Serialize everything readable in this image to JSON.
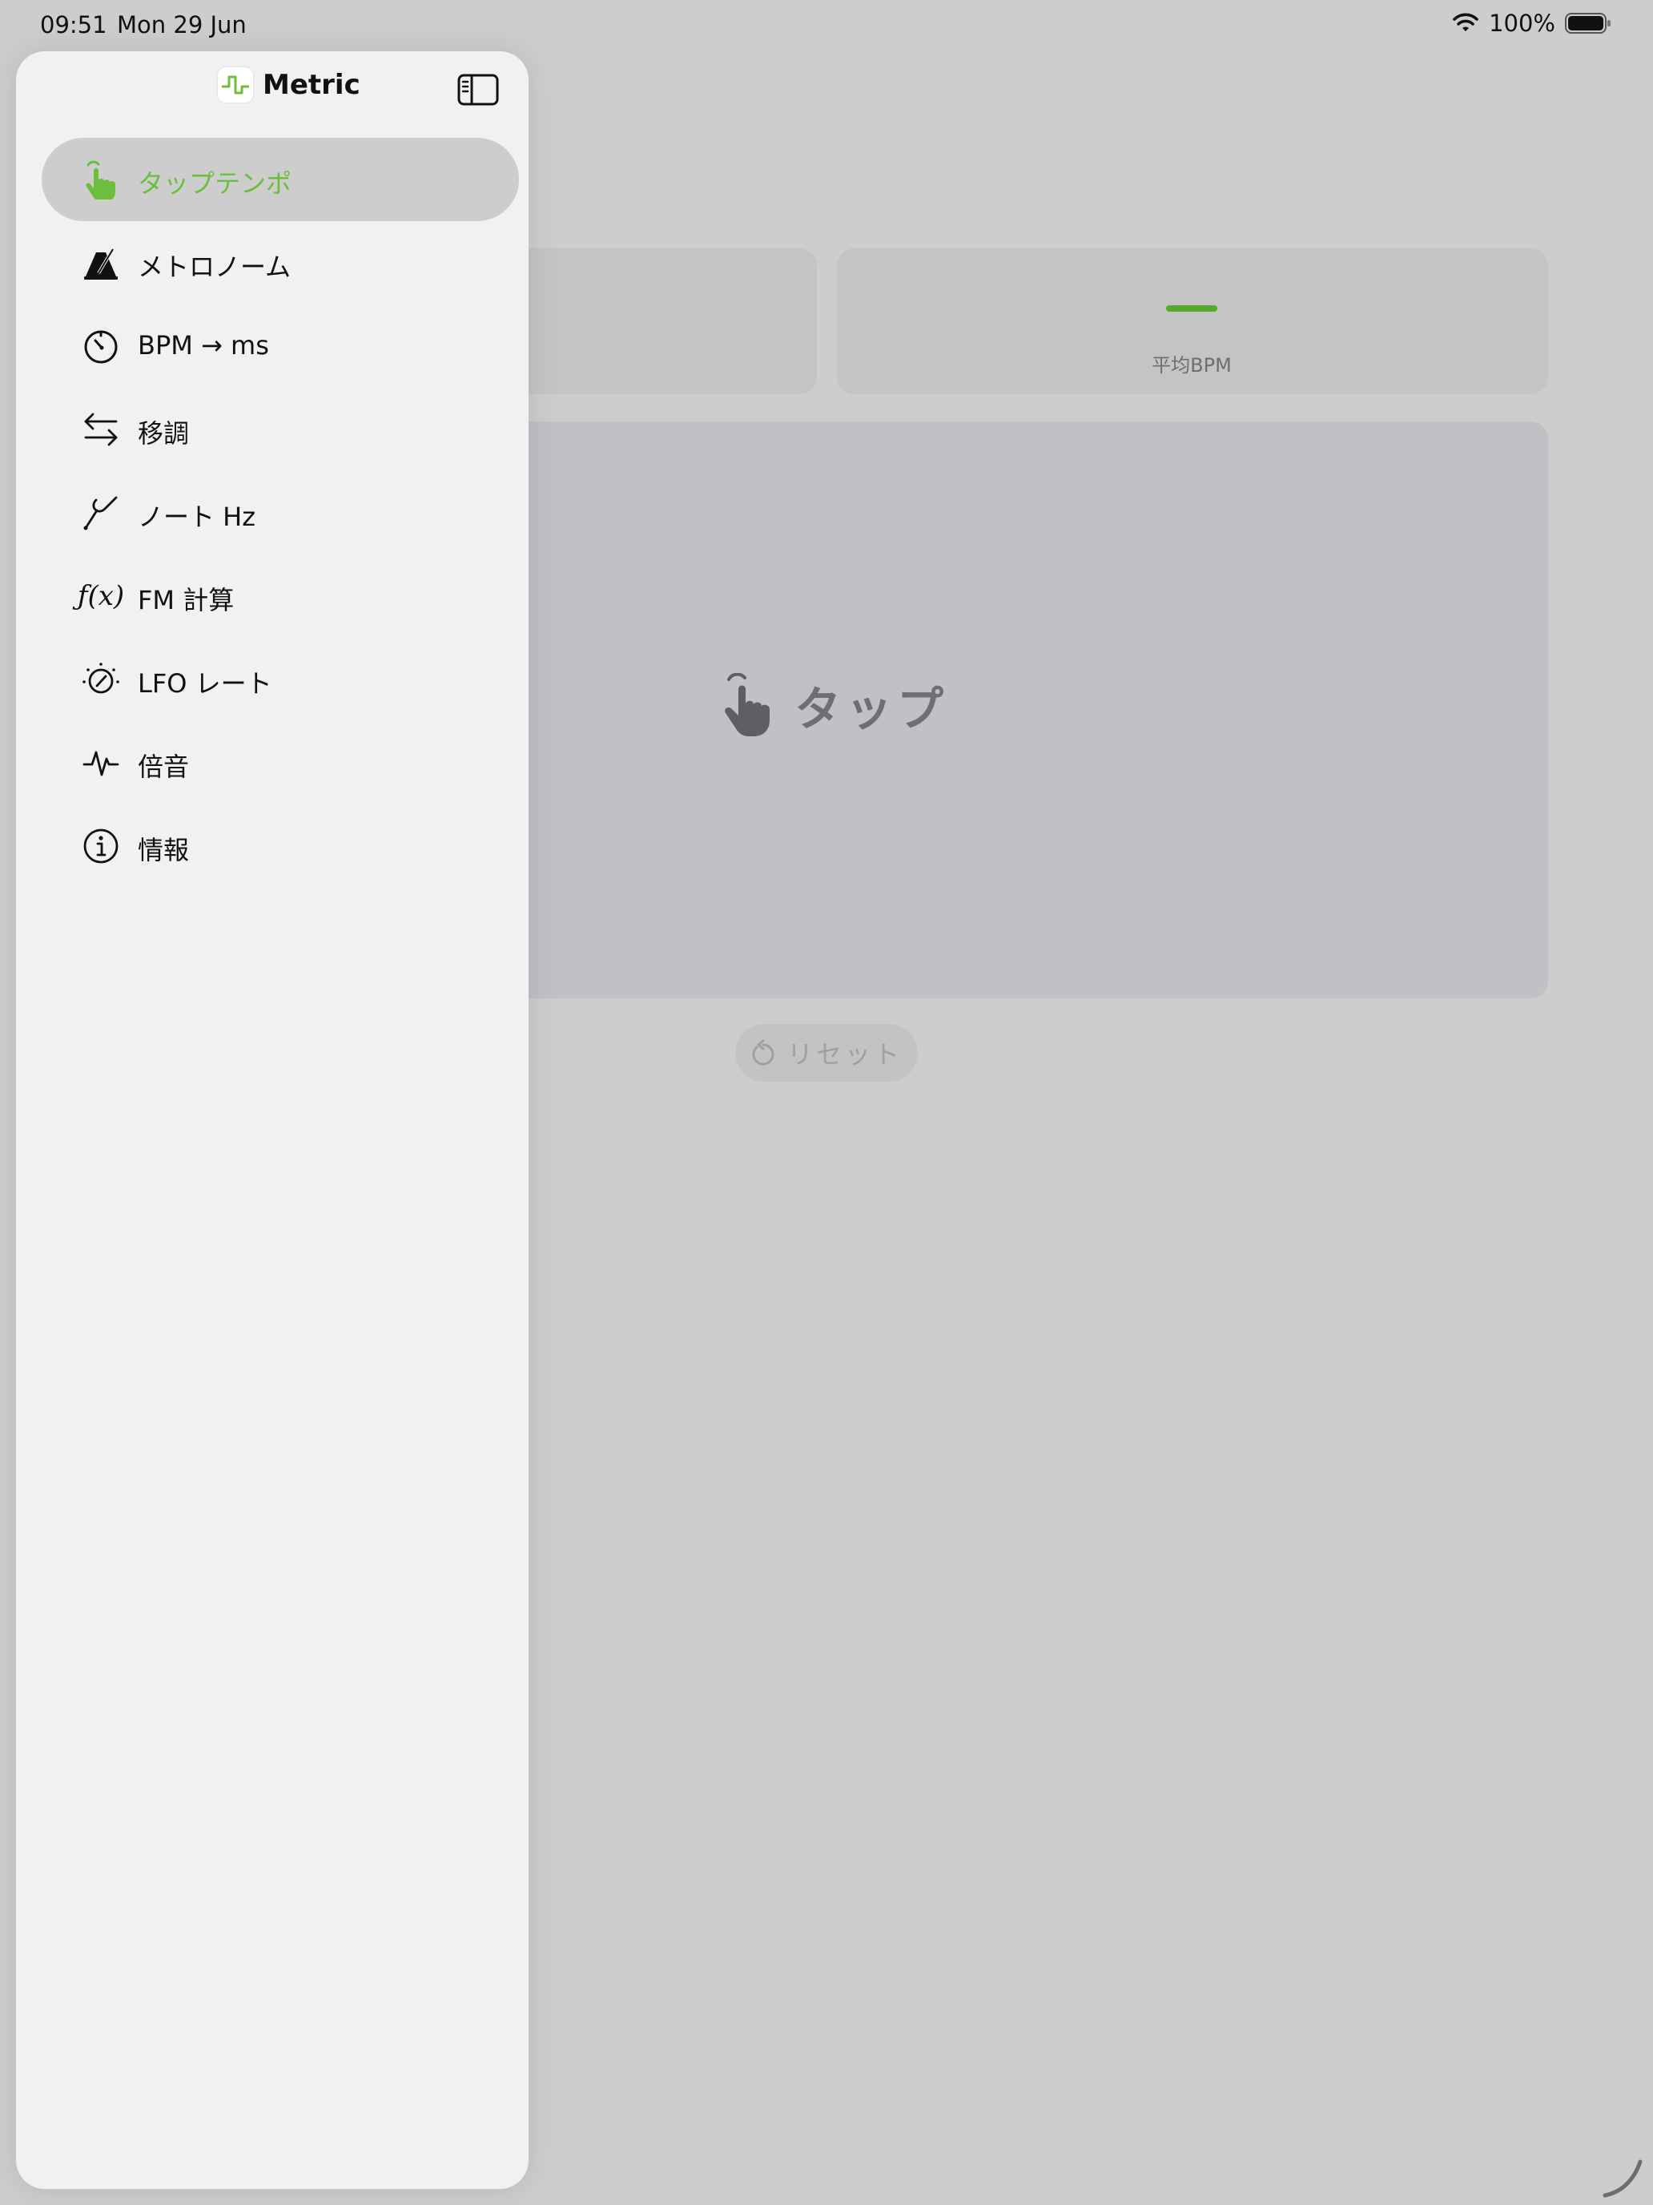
{
  "status_bar": {
    "time": "09:51",
    "date": "Mon 29 Jun",
    "battery": "100%"
  },
  "sidebar": {
    "app_title": "Metric",
    "items": [
      {
        "label": "タップテンポ",
        "icon": "hand-tap-icon",
        "selected": true
      },
      {
        "label": "メトロノーム",
        "icon": "metronome-icon",
        "selected": false
      },
      {
        "label": "BPM → ms",
        "icon": "timer-icon",
        "selected": false
      },
      {
        "label": "移調",
        "icon": "transpose-arrows-icon",
        "selected": false
      },
      {
        "label": "ノート Hz",
        "icon": "tuning-fork-icon",
        "selected": false
      },
      {
        "label": "FM 計算",
        "icon": "function-icon",
        "selected": false
      },
      {
        "label": "LFO レート",
        "icon": "lfo-dial-icon",
        "selected": false
      },
      {
        "label": "倍音",
        "icon": "waveform-icon",
        "selected": false
      },
      {
        "label": "情報",
        "icon": "info-icon",
        "selected": false
      }
    ]
  },
  "main": {
    "avg_bpm_value": "—",
    "avg_bpm_label": "平均BPM",
    "tap_label": "タップ",
    "reset_label": "リセット"
  },
  "colors": {
    "accent": "#6cbf3d",
    "sidebar_bg": "#f1f1f1",
    "selected_bg": "#cdcdcd",
    "dim_bg": "#cdcdcd"
  }
}
